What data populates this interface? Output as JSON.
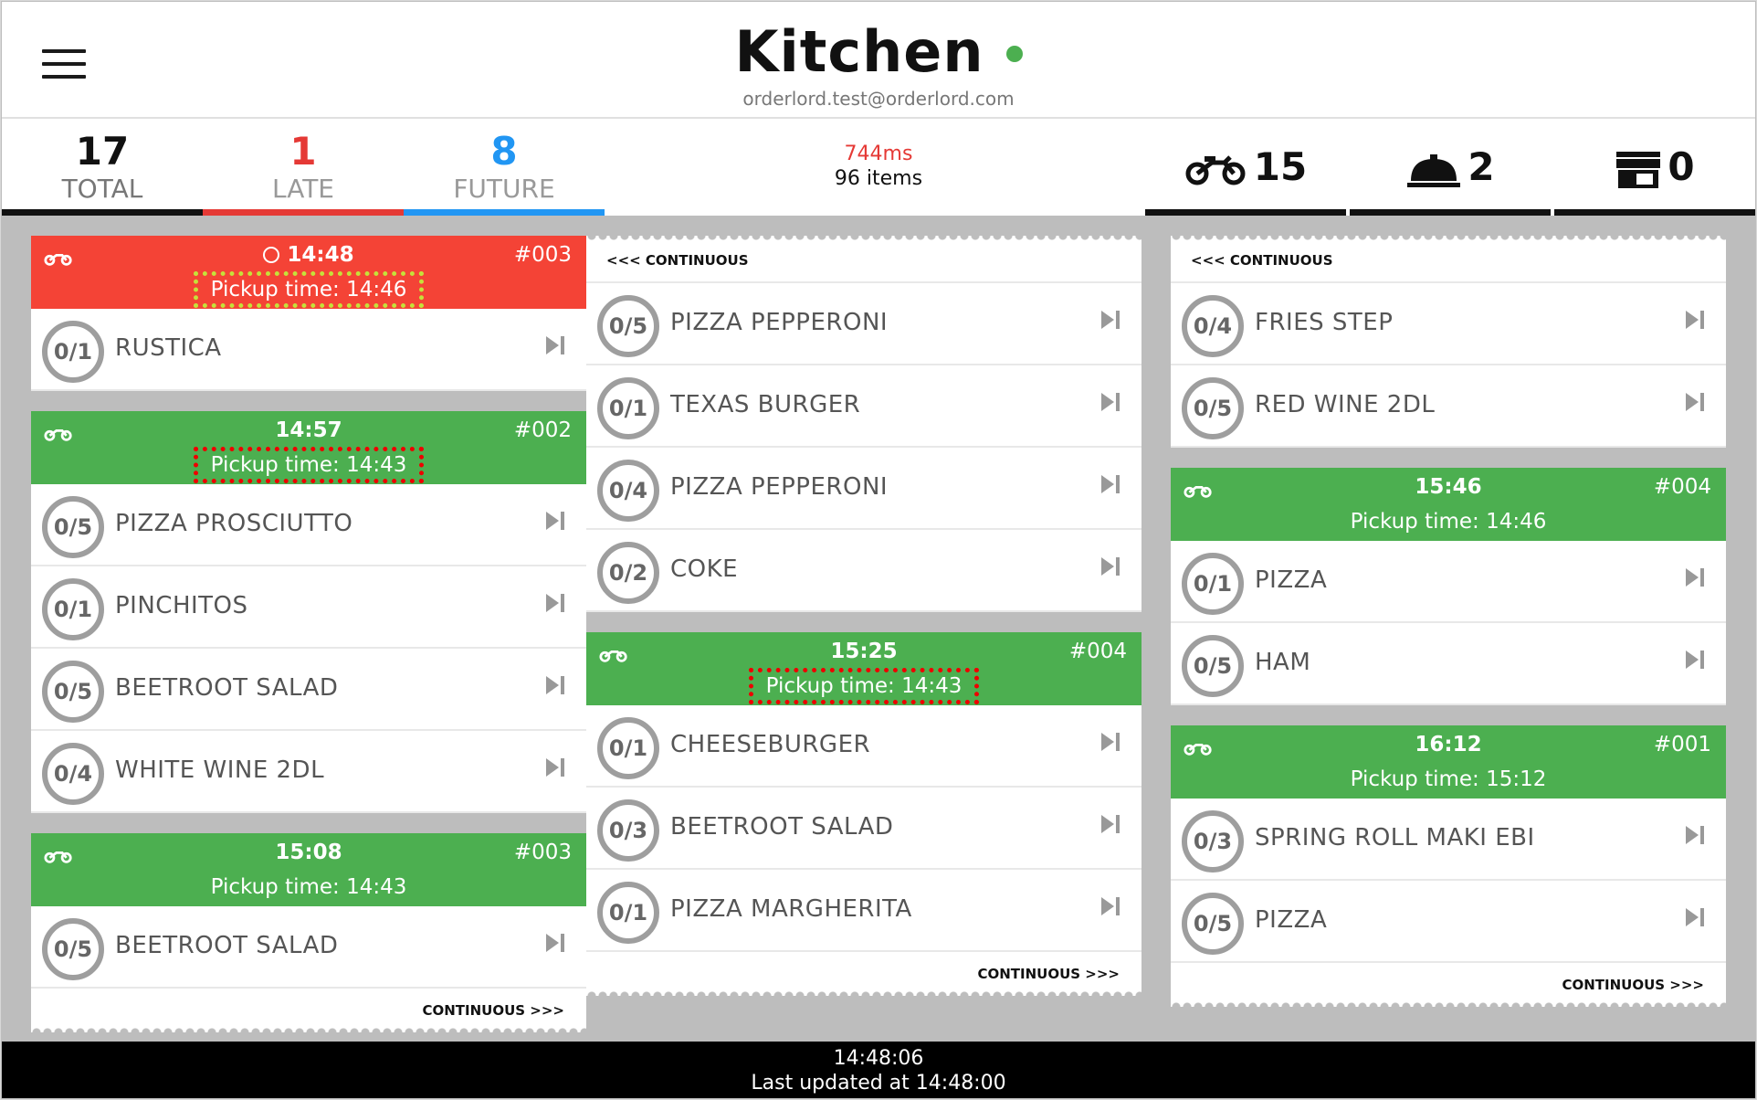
{
  "header": {
    "title": "Kitchen",
    "account": "orderlord.test@orderlord.com",
    "status_color": "#4caf50"
  },
  "stats": {
    "total": {
      "value": "17",
      "label": "TOTAL",
      "color": "#111111"
    },
    "late": {
      "value": "1",
      "label": "LATE",
      "color": "#e53935"
    },
    "future": {
      "value": "8",
      "label": "FUTURE",
      "color": "#2196f3"
    }
  },
  "perf": {
    "latency": "744ms",
    "items": "96 items"
  },
  "counters": {
    "delivery": "15",
    "dine_in": "2",
    "takeaway": "0"
  },
  "continuous_prev": "<<< CONTINUOUS",
  "continuous_next": "CONTINUOUS >>>",
  "columns": {
    "c1": {
      "t1": {
        "time": "14:48",
        "number": "#003",
        "pickup": "Pickup time: 14:46",
        "items": [
          {
            "done": "0",
            "qty": "1",
            "name": "RUSTICA"
          }
        ]
      },
      "t2": {
        "time": "14:57",
        "number": "#002",
        "pickup": "Pickup time: 14:43",
        "items": [
          {
            "done": "0",
            "qty": "5",
            "name": "PIZZA PROSCIUTTO"
          },
          {
            "done": "0",
            "qty": "1",
            "name": "PINCHITOS"
          },
          {
            "done": "0",
            "qty": "5",
            "name": "BEETROOT SALAD"
          },
          {
            "done": "0",
            "qty": "4",
            "name": "WHITE WINE 2DL"
          }
        ]
      },
      "t3": {
        "time": "15:08",
        "number": "#003",
        "pickup": "Pickup time: 14:43",
        "items": [
          {
            "done": "0",
            "qty": "5",
            "name": "BEETROOT SALAD"
          }
        ]
      }
    },
    "c2": {
      "t1": {
        "items": [
          {
            "done": "0",
            "qty": "5",
            "name": "PIZZA PEPPERONI"
          },
          {
            "done": "0",
            "qty": "1",
            "name": "TEXAS BURGER"
          },
          {
            "done": "0",
            "qty": "4",
            "name": "PIZZA PEPPERONI"
          },
          {
            "done": "0",
            "qty": "2",
            "name": "COKE"
          }
        ]
      },
      "t2": {
        "time": "15:25",
        "number": "#004",
        "pickup": "Pickup time: 14:43",
        "items": [
          {
            "done": "0",
            "qty": "1",
            "name": "CHEESEBURGER"
          },
          {
            "done": "0",
            "qty": "3",
            "name": "BEETROOT SALAD"
          },
          {
            "done": "0",
            "qty": "1",
            "name": "PIZZA MARGHERITA"
          }
        ]
      }
    },
    "c3": {
      "t1": {
        "items": [
          {
            "done": "0",
            "qty": "4",
            "name": "FRIES STEP"
          },
          {
            "done": "0",
            "qty": "5",
            "name": "RED WINE 2DL"
          }
        ]
      },
      "t2": {
        "time": "15:46",
        "number": "#004",
        "pickup": "Pickup time: 14:46",
        "items": [
          {
            "done": "0",
            "qty": "1",
            "name": "PIZZA"
          },
          {
            "done": "0",
            "qty": "5",
            "name": "HAM"
          }
        ]
      },
      "t3": {
        "time": "16:12",
        "number": "#001",
        "pickup": "Pickup time: 15:12",
        "items": [
          {
            "done": "0",
            "qty": "3",
            "name": "SPRING ROLL MAKI EBI"
          },
          {
            "done": "0",
            "qty": "5",
            "name": "PIZZA"
          }
        ]
      }
    }
  },
  "footer": {
    "clock": "14:48:06",
    "updated": "Last updated at 14:48:00"
  }
}
